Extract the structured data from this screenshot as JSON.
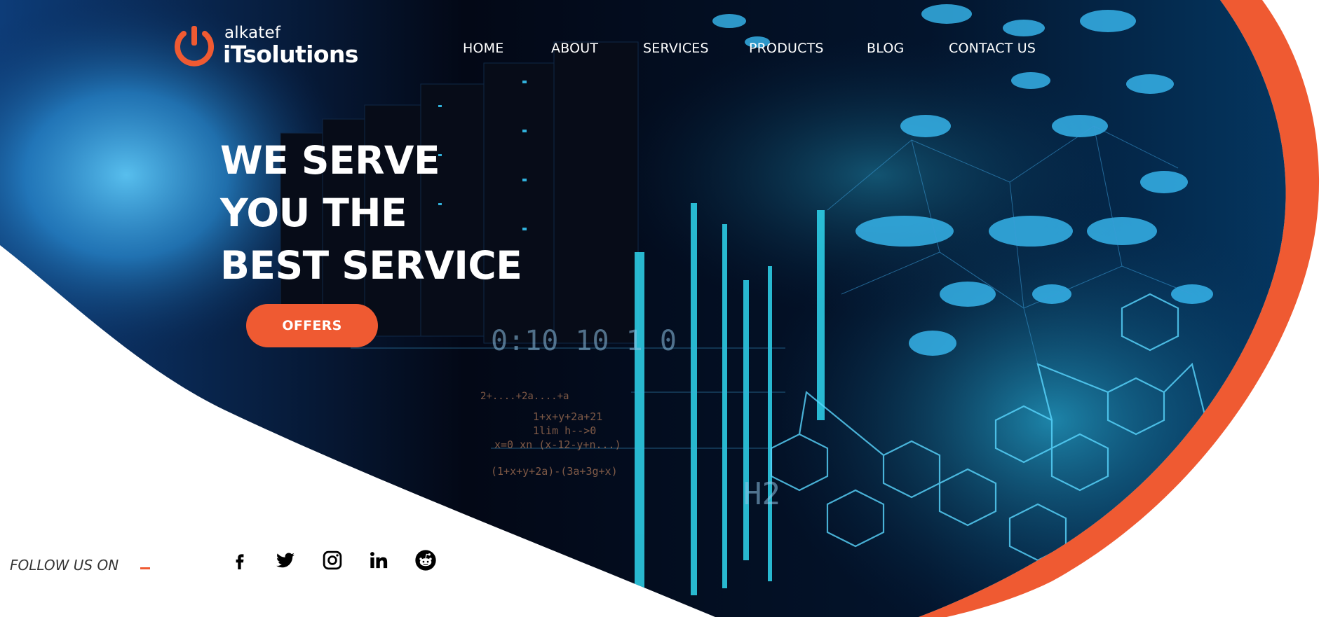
{
  "brand": {
    "name_small": "alkatef",
    "name_big": "iTsolutions",
    "accent_color": "#ef5a32"
  },
  "nav": {
    "items": [
      {
        "label": "HOME"
      },
      {
        "label": "ABOUT"
      },
      {
        "label": "SERVICES"
      },
      {
        "label": "PRODUCTS"
      },
      {
        "label": "BLOG"
      },
      {
        "label": "CONTACT US"
      }
    ]
  },
  "hero": {
    "headline_lines": [
      "WE SERVE",
      "YOU THE",
      "BEST SERVICE"
    ],
    "cta_label": "OFFERS",
    "background_texts": [
      "0:10 10 1 0",
      "1+x+y+2a+21",
      "1lim h-->0",
      "x=0 xn (x-12-y+n...)",
      "(1+x+y+2a)-(3a+3g+x)",
      "2+....+2a....+a",
      "H2"
    ]
  },
  "follow": {
    "label": "FOLLOW US ON",
    "icons": [
      "facebook-icon",
      "twitter-icon",
      "instagram-icon",
      "linkedin-icon",
      "reddit-icon"
    ]
  }
}
